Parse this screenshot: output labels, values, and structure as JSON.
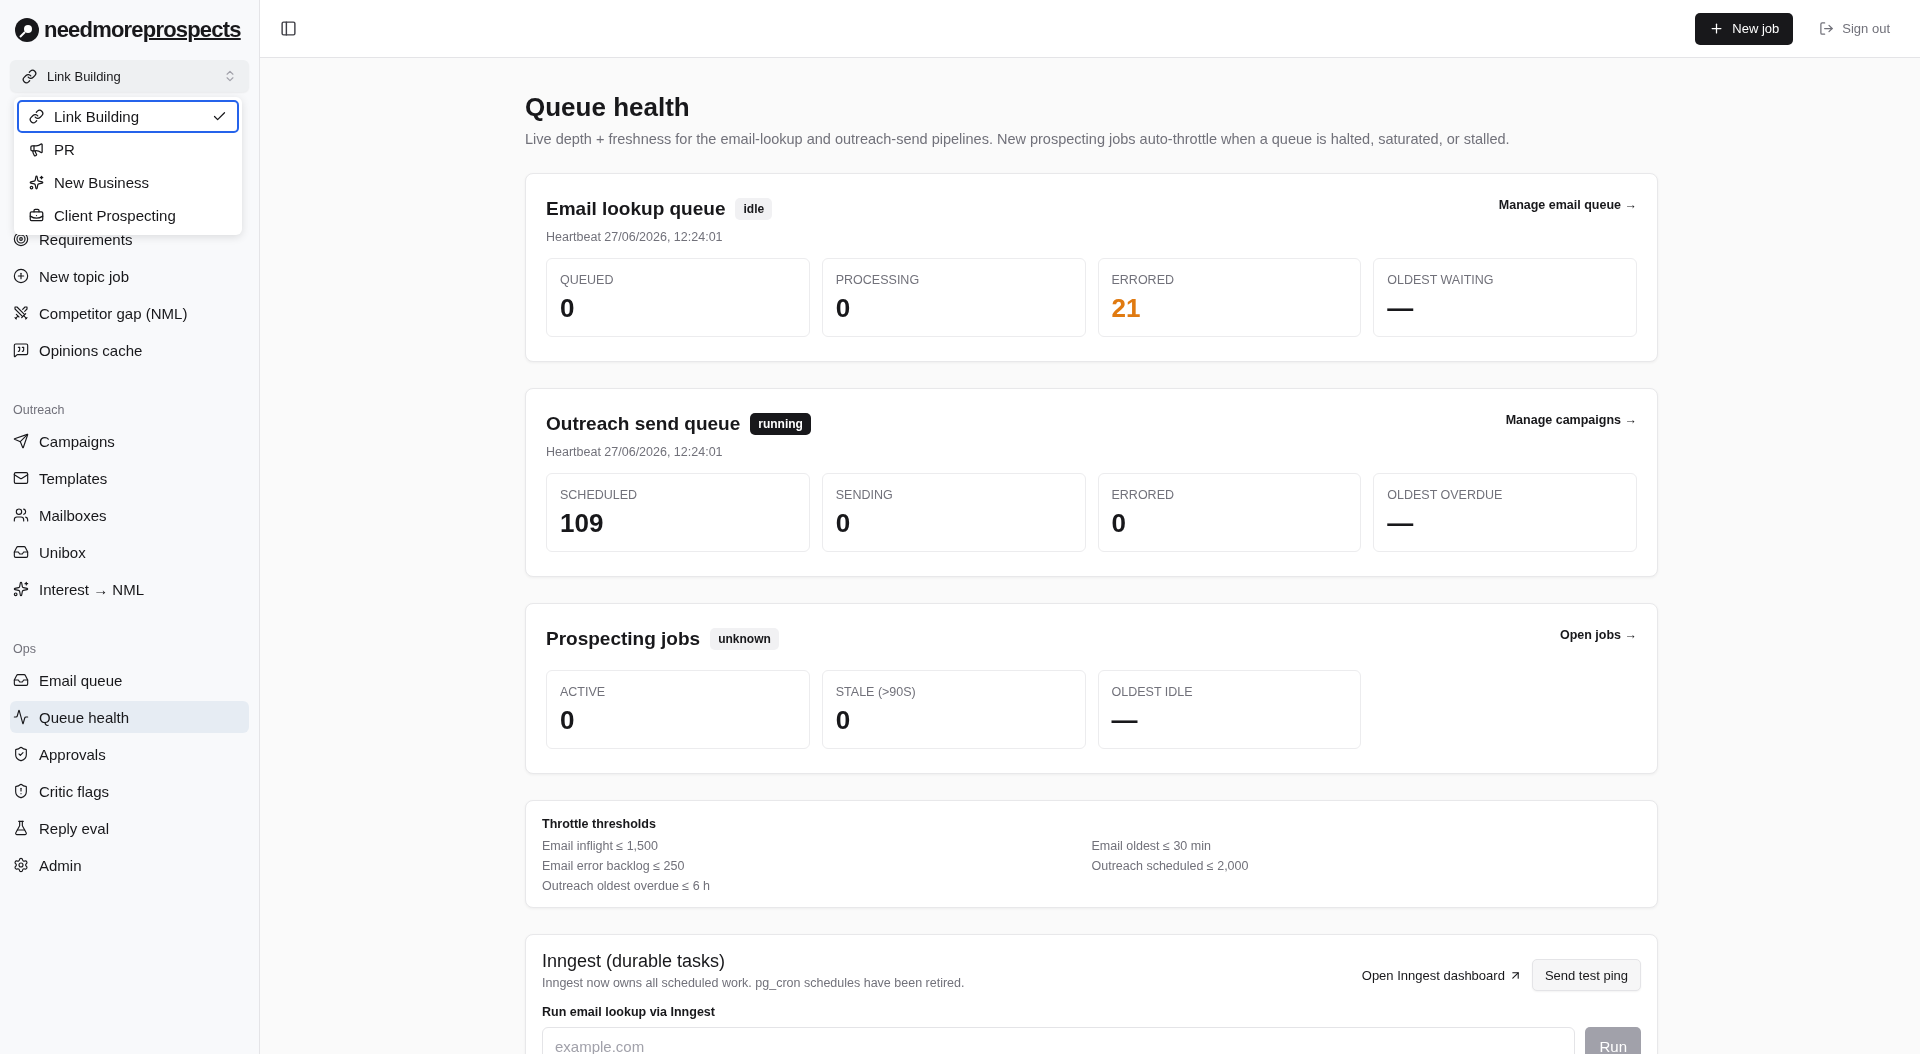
{
  "brand": {
    "name_start": "needmore",
    "name_end": "prospects"
  },
  "workspace_switcher": {
    "value": "Link Building",
    "expanded": true,
    "options": [
      {
        "label": "Link Building",
        "selected": true
      },
      {
        "label": "PR",
        "selected": false
      },
      {
        "label": "New Business",
        "selected": false
      },
      {
        "label": "Client Prospecting",
        "selected": false
      }
    ]
  },
  "sidebar": {
    "sections": [
      {
        "items": [
          {
            "label": "Requirements",
            "selected": false
          },
          {
            "label": "New topic job",
            "selected": false
          },
          {
            "label": "Competitor gap (NML)",
            "selected": false
          },
          {
            "label": "Opinions cache",
            "selected": false
          }
        ]
      },
      {
        "heading": "Outreach",
        "items": [
          {
            "label": "Campaigns",
            "selected": false
          },
          {
            "label": "Templates",
            "selected": false
          },
          {
            "label": "Mailboxes",
            "selected": false
          },
          {
            "label": "Unibox",
            "selected": false
          },
          {
            "label": "Interest → NML",
            "selected": false
          }
        ]
      },
      {
        "heading": "Ops",
        "items": [
          {
            "label": "Email queue",
            "selected": false
          },
          {
            "label": "Queue health",
            "selected": true
          },
          {
            "label": "Approvals",
            "selected": false
          },
          {
            "label": "Critic flags",
            "selected": false
          },
          {
            "label": "Reply eval",
            "selected": false
          },
          {
            "label": "Admin",
            "selected": false
          }
        ]
      }
    ]
  },
  "topbar": {
    "new_job": "New job",
    "sign_out": "Sign out"
  },
  "page": {
    "title": "Queue health",
    "subtitle": "Live depth + freshness for the email-lookup and outreach-send pipelines. New prospecting jobs auto-throttle when a queue is halted, saturated, or stalled."
  },
  "queues": [
    {
      "title": "Email lookup queue",
      "badge": {
        "text": "idle",
        "kind": "light"
      },
      "heartbeat": "Heartbeat 27/06/2026, 12:24:01",
      "link": "Manage email queue →",
      "stats": [
        {
          "label": "QUEUED",
          "value": "0",
          "alert": false
        },
        {
          "label": "PROCESSING",
          "value": "0",
          "alert": false
        },
        {
          "label": "ERRORED",
          "value": "21",
          "alert": true
        },
        {
          "label": "OLDEST WAITING",
          "value": "—",
          "alert": false
        }
      ]
    },
    {
      "title": "Outreach send queue",
      "badge": {
        "text": "running",
        "kind": "dark"
      },
      "heartbeat": "Heartbeat 27/06/2026, 12:24:01",
      "link": "Manage campaigns →",
      "stats": [
        {
          "label": "SCHEDULED",
          "value": "109",
          "alert": false
        },
        {
          "label": "SENDING",
          "value": "0",
          "alert": false
        },
        {
          "label": "ERRORED",
          "value": "0",
          "alert": false
        },
        {
          "label": "OLDEST OVERDUE",
          "value": "—",
          "alert": false
        }
      ]
    },
    {
      "title": "Prospecting jobs",
      "badge": {
        "text": "unknown",
        "kind": "light"
      },
      "link": "Open jobs →",
      "stats": [
        {
          "label": "ACTIVE",
          "value": "0",
          "alert": false
        },
        {
          "label": "STALE (>90S)",
          "value": "0",
          "alert": false
        },
        {
          "label": "OLDEST IDLE",
          "value": "—",
          "alert": false
        }
      ]
    }
  ],
  "thresholds": {
    "title": "Throttle thresholds",
    "columns": [
      [
        "Email inflight ≤ 1,500",
        "Email error backlog ≤ 250",
        "Outreach oldest overdue ≤ 6 h"
      ],
      [
        "Email oldest ≤ 30 min",
        "Outreach scheduled ≤ 2,000"
      ]
    ]
  },
  "inngest": {
    "title": "Inngest (durable tasks)",
    "subtitle": "Inngest now owns all scheduled work. pg_cron schedules have been retired.",
    "dashboard_link": "Open Inngest dashboard",
    "ping_button": "Send test ping",
    "field_label": "Run email lookup via Inngest",
    "placeholder": "example.com",
    "run_button": {
      "label": "Run",
      "disabled": true
    }
  }
}
